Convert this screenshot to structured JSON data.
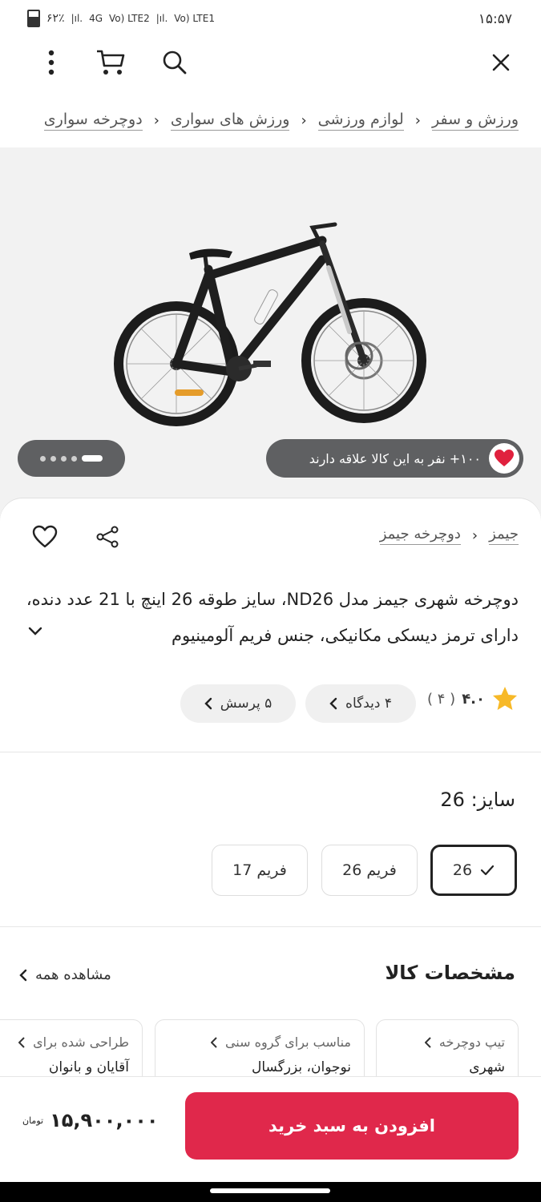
{
  "status_bar": {
    "time": "۱۵:۵۷",
    "battery": "۶۲٪",
    "network_1": "4G",
    "network_2": "Vo) LTE2",
    "network_3": "Vo) LTE1"
  },
  "toolbar": {
    "close_icon": "close-icon",
    "search_icon": "search-icon",
    "cart_icon": "cart-icon",
    "more_icon": "more-vert-icon"
  },
  "breadcrumb": {
    "items": [
      "ورزش و سفر",
      "لوازم ورزشی",
      "ورزش های سواری",
      "دوچرخه سواری"
    ],
    "separator": "‹"
  },
  "gallery": {
    "likes_text": "۱۰۰+ نفر به این کالا علاقه دارند",
    "image_count": 5,
    "active_index": 0
  },
  "product": {
    "brand": "جیمز",
    "category": "دوچرخه جیمز",
    "title": "دوچرخه شهری جیمز مدل ND26، سایز طوقه 26 اینچ با 21 عدد دنده، دارای ترمز دیسکی مکانیکی، جنس فریم آلومینیوم",
    "rating": "۴.۰",
    "rating_count": "( ۴ )",
    "reviews_chip": "۴ دیدگاه",
    "questions_chip": "۵ پرسش"
  },
  "size": {
    "title": "سایز: 26",
    "options": [
      {
        "label": "26",
        "selected": true
      },
      {
        "label": "فریم 26",
        "selected": false
      },
      {
        "label": "فریم 17",
        "selected": false
      }
    ]
  },
  "specs": {
    "title": "مشخصات کالا",
    "see_all": "مشاهده همه",
    "cards": [
      {
        "label": "تیپ دوچرخه",
        "value": "شهری"
      },
      {
        "label": "مناسب برای گروه سنی",
        "value": "نوجوان، بزرگسال"
      },
      {
        "label": "طراحی شده برای",
        "value": "آقایان و بانوان"
      }
    ]
  },
  "buy_bar": {
    "button_label": "افزودن به سبد خرید",
    "price": "۱۵,۹۰۰,۰۰۰",
    "currency": "تومان"
  },
  "colors": {
    "accent": "#e0284b",
    "pill": "#5f6062"
  }
}
